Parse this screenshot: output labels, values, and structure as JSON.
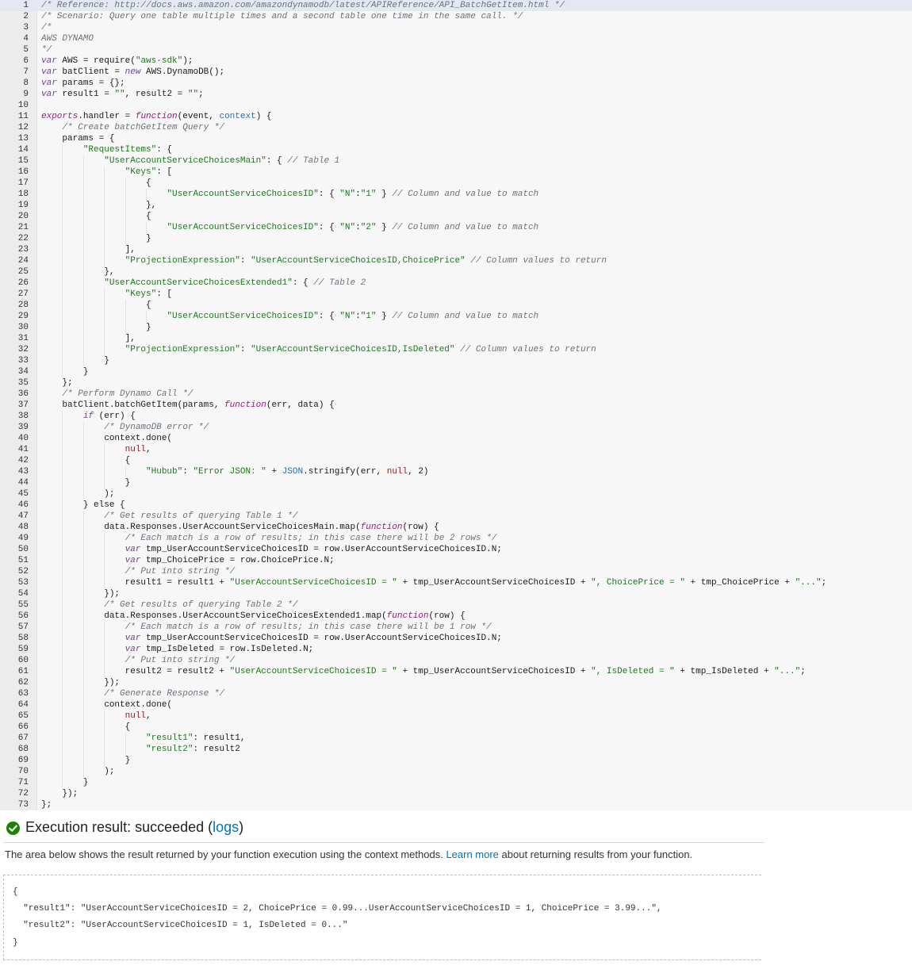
{
  "editor": {
    "active_line": 1,
    "lines": [
      [
        {
          "t": "c",
          "v": "/* Reference: http://docs.aws.amazon.com/amazondynamodb/latest/APIReference/API_BatchGetItem.html */"
        }
      ],
      [
        {
          "t": "c",
          "v": "/* Scenario: Query one table multiple times and a second table one time in the same call. */"
        }
      ],
      [
        {
          "t": "c",
          "v": "/*"
        }
      ],
      [
        {
          "t": "c",
          "v": "AWS DYNAMO"
        }
      ],
      [
        {
          "t": "c",
          "v": "*/"
        }
      ],
      [
        {
          "t": "k",
          "v": "var"
        },
        {
          "t": "n",
          "v": " AWS = require("
        },
        {
          "t": "s",
          "v": "\"aws-sdk\""
        },
        {
          "t": "n",
          "v": ");"
        }
      ],
      [
        {
          "t": "k",
          "v": "var"
        },
        {
          "t": "n",
          "v": " batClient = "
        },
        {
          "t": "k",
          "v": "new"
        },
        {
          "t": "n",
          "v": " AWS.DynamoDB();"
        }
      ],
      [
        {
          "t": "k",
          "v": "var"
        },
        {
          "t": "n",
          "v": " params = {};"
        }
      ],
      [
        {
          "t": "k",
          "v": "var"
        },
        {
          "t": "n",
          "v": " result1 = "
        },
        {
          "t": "s",
          "v": "\"\""
        },
        {
          "t": "n",
          "v": ", result2 = "
        },
        {
          "t": "s",
          "v": "\"\""
        },
        {
          "t": "n",
          "v": ";"
        }
      ],
      [],
      [
        {
          "t": "f",
          "v": "exports"
        },
        {
          "t": "n",
          "v": ".handler = "
        },
        {
          "t": "f",
          "v": "function"
        },
        {
          "t": "n",
          "v": "(event, "
        },
        {
          "t": "v",
          "v": "context"
        },
        {
          "t": "n",
          "v": ") {"
        }
      ],
      [
        {
          "t": "n",
          "v": "    "
        },
        {
          "t": "c",
          "v": "/* Create batchGetItem Query */"
        }
      ],
      [
        {
          "t": "n",
          "v": "    params = {"
        }
      ],
      [
        {
          "t": "n",
          "v": "        "
        },
        {
          "t": "s",
          "v": "\"RequestItems\""
        },
        {
          "t": "n",
          "v": ": {"
        }
      ],
      [
        {
          "t": "n",
          "v": "            "
        },
        {
          "t": "s",
          "v": "\"UserAccountServiceChoicesMain\""
        },
        {
          "t": "n",
          "v": ": { "
        },
        {
          "t": "c",
          "v": "// Table 1"
        }
      ],
      [
        {
          "t": "n",
          "v": "                "
        },
        {
          "t": "s",
          "v": "\"Keys\""
        },
        {
          "t": "n",
          "v": ": ["
        }
      ],
      [
        {
          "t": "n",
          "v": "                    {"
        }
      ],
      [
        {
          "t": "n",
          "v": "                        "
        },
        {
          "t": "s",
          "v": "\"UserAccountServiceChoicesID\""
        },
        {
          "t": "n",
          "v": ": { "
        },
        {
          "t": "s",
          "v": "\"N\""
        },
        {
          "t": "n",
          "v": ":"
        },
        {
          "t": "s",
          "v": "\"1\""
        },
        {
          "t": "n",
          "v": " } "
        },
        {
          "t": "c",
          "v": "// Column and value to match"
        }
      ],
      [
        {
          "t": "n",
          "v": "                    },"
        }
      ],
      [
        {
          "t": "n",
          "v": "                    {"
        }
      ],
      [
        {
          "t": "n",
          "v": "                        "
        },
        {
          "t": "s",
          "v": "\"UserAccountServiceChoicesID\""
        },
        {
          "t": "n",
          "v": ": { "
        },
        {
          "t": "s",
          "v": "\"N\""
        },
        {
          "t": "n",
          "v": ":"
        },
        {
          "t": "s",
          "v": "\"2\""
        },
        {
          "t": "n",
          "v": " } "
        },
        {
          "t": "c",
          "v": "// Column and value to match"
        }
      ],
      [
        {
          "t": "n",
          "v": "                    }"
        }
      ],
      [
        {
          "t": "n",
          "v": "                ],"
        }
      ],
      [
        {
          "t": "n",
          "v": "                "
        },
        {
          "t": "s",
          "v": "\"ProjectionExpression\""
        },
        {
          "t": "n",
          "v": ": "
        },
        {
          "t": "s",
          "v": "\"UserAccountServiceChoicesID,ChoicePrice\""
        },
        {
          "t": "n",
          "v": " "
        },
        {
          "t": "c",
          "v": "// Column values to return"
        }
      ],
      [
        {
          "t": "n",
          "v": "            },"
        }
      ],
      [
        {
          "t": "n",
          "v": "            "
        },
        {
          "t": "s",
          "v": "\"UserAccountServiceChoicesExtended1\""
        },
        {
          "t": "n",
          "v": ": { "
        },
        {
          "t": "c",
          "v": "// Table 2"
        }
      ],
      [
        {
          "t": "n",
          "v": "                "
        },
        {
          "t": "s",
          "v": "\"Keys\""
        },
        {
          "t": "n",
          "v": ": ["
        }
      ],
      [
        {
          "t": "n",
          "v": "                    {"
        }
      ],
      [
        {
          "t": "n",
          "v": "                        "
        },
        {
          "t": "s",
          "v": "\"UserAccountServiceChoicesID\""
        },
        {
          "t": "n",
          "v": ": { "
        },
        {
          "t": "s",
          "v": "\"N\""
        },
        {
          "t": "n",
          "v": ":"
        },
        {
          "t": "s",
          "v": "\"1\""
        },
        {
          "t": "n",
          "v": " } "
        },
        {
          "t": "c",
          "v": "// Column and value to match"
        }
      ],
      [
        {
          "t": "n",
          "v": "                    }"
        }
      ],
      [
        {
          "t": "n",
          "v": "                ],"
        }
      ],
      [
        {
          "t": "n",
          "v": "                "
        },
        {
          "t": "s",
          "v": "\"ProjectionExpression\""
        },
        {
          "t": "n",
          "v": ": "
        },
        {
          "t": "s",
          "v": "\"UserAccountServiceChoicesID,IsDeleted\""
        },
        {
          "t": "n",
          "v": " "
        },
        {
          "t": "c",
          "v": "// Column values to return"
        }
      ],
      [
        {
          "t": "n",
          "v": "            }"
        }
      ],
      [
        {
          "t": "n",
          "v": "        }"
        }
      ],
      [
        {
          "t": "n",
          "v": "    };"
        }
      ],
      [
        {
          "t": "n",
          "v": "    "
        },
        {
          "t": "c",
          "v": "/* Perform Dynamo Call */"
        }
      ],
      [
        {
          "t": "n",
          "v": "    batClient.batchGetItem(params, "
        },
        {
          "t": "f",
          "v": "function"
        },
        {
          "t": "n",
          "v": "(err, data) {"
        }
      ],
      [
        {
          "t": "n",
          "v": "        "
        },
        {
          "t": "k",
          "v": "if"
        },
        {
          "t": "n",
          "v": " (err) {"
        }
      ],
      [
        {
          "t": "n",
          "v": "            "
        },
        {
          "t": "c",
          "v": "/* DynamoDB error */"
        }
      ],
      [
        {
          "t": "n",
          "v": "            context.done("
        }
      ],
      [
        {
          "t": "n",
          "v": "                "
        },
        {
          "t": "b",
          "v": "null"
        },
        {
          "t": "n",
          "v": ","
        }
      ],
      [
        {
          "t": "n",
          "v": "                {"
        }
      ],
      [
        {
          "t": "n",
          "v": "                    "
        },
        {
          "t": "s",
          "v": "\"Hubub\""
        },
        {
          "t": "n",
          "v": ": "
        },
        {
          "t": "s",
          "v": "\"Error JSON: \""
        },
        {
          "t": "n",
          "v": " + "
        },
        {
          "t": "v",
          "v": "JSON"
        },
        {
          "t": "n",
          "v": ".stringify(err, "
        },
        {
          "t": "b",
          "v": "null"
        },
        {
          "t": "n",
          "v": ", 2)"
        }
      ],
      [
        {
          "t": "n",
          "v": "                }"
        }
      ],
      [
        {
          "t": "n",
          "v": "            );"
        }
      ],
      [
        {
          "t": "n",
          "v": "        } else {"
        }
      ],
      [
        {
          "t": "n",
          "v": "            "
        },
        {
          "t": "c",
          "v": "/* Get results of querying Table 1 */"
        }
      ],
      [
        {
          "t": "n",
          "v": "            data.Responses.UserAccountServiceChoicesMain.map("
        },
        {
          "t": "f",
          "v": "function"
        },
        {
          "t": "n",
          "v": "(row) {"
        }
      ],
      [
        {
          "t": "n",
          "v": "                "
        },
        {
          "t": "c",
          "v": "/* Each match is a row of results; in this case there will be 2 rows */"
        }
      ],
      [
        {
          "t": "n",
          "v": "                "
        },
        {
          "t": "k",
          "v": "var"
        },
        {
          "t": "n",
          "v": " tmp_UserAccountServiceChoicesID = row.UserAccountServiceChoicesID.N;"
        }
      ],
      [
        {
          "t": "n",
          "v": "                "
        },
        {
          "t": "k",
          "v": "var"
        },
        {
          "t": "n",
          "v": " tmp_ChoicePrice = row.ChoicePrice.N;"
        }
      ],
      [
        {
          "t": "n",
          "v": "                "
        },
        {
          "t": "c",
          "v": "/* Put into string */"
        }
      ],
      [
        {
          "t": "n",
          "v": "                result1 = result1 + "
        },
        {
          "t": "s",
          "v": "\"UserAccountServiceChoicesID = \""
        },
        {
          "t": "n",
          "v": " + tmp_UserAccountServiceChoicesID + "
        },
        {
          "t": "s",
          "v": "\", ChoicePrice = \""
        },
        {
          "t": "n",
          "v": " + tmp_ChoicePrice + "
        },
        {
          "t": "s",
          "v": "\"...\""
        },
        {
          "t": "n",
          "v": ";"
        }
      ],
      [
        {
          "t": "n",
          "v": "            });"
        }
      ],
      [
        {
          "t": "n",
          "v": "            "
        },
        {
          "t": "c",
          "v": "/* Get results of querying Table 2 */"
        }
      ],
      [
        {
          "t": "n",
          "v": "            data.Responses.UserAccountServiceChoicesExtended1.map("
        },
        {
          "t": "f",
          "v": "function"
        },
        {
          "t": "n",
          "v": "(row) {"
        }
      ],
      [
        {
          "t": "n",
          "v": "                "
        },
        {
          "t": "c",
          "v": "/* Each match is a row of results; in this case there will be 1 row */"
        }
      ],
      [
        {
          "t": "n",
          "v": "                "
        },
        {
          "t": "k",
          "v": "var"
        },
        {
          "t": "n",
          "v": " tmp_UserAccountServiceChoicesID = row.UserAccountServiceChoicesID.N;"
        }
      ],
      [
        {
          "t": "n",
          "v": "                "
        },
        {
          "t": "k",
          "v": "var"
        },
        {
          "t": "n",
          "v": " tmp_IsDeleted = row.IsDeleted.N;"
        }
      ],
      [
        {
          "t": "n",
          "v": "                "
        },
        {
          "t": "c",
          "v": "/* Put into string */"
        }
      ],
      [
        {
          "t": "n",
          "v": "                result2 = result2 + "
        },
        {
          "t": "s",
          "v": "\"UserAccountServiceChoicesID = \""
        },
        {
          "t": "n",
          "v": " + tmp_UserAccountServiceChoicesID + "
        },
        {
          "t": "s",
          "v": "\", IsDeleted = \""
        },
        {
          "t": "n",
          "v": " + tmp_IsDeleted + "
        },
        {
          "t": "s",
          "v": "\"...\""
        },
        {
          "t": "n",
          "v": ";"
        }
      ],
      [
        {
          "t": "n",
          "v": "            });"
        }
      ],
      [
        {
          "t": "n",
          "v": "            "
        },
        {
          "t": "c",
          "v": "/* Generate Response */"
        }
      ],
      [
        {
          "t": "n",
          "v": "            context.done("
        }
      ],
      [
        {
          "t": "n",
          "v": "                "
        },
        {
          "t": "b",
          "v": "null"
        },
        {
          "t": "n",
          "v": ","
        }
      ],
      [
        {
          "t": "n",
          "v": "                {"
        }
      ],
      [
        {
          "t": "n",
          "v": "                    "
        },
        {
          "t": "s",
          "v": "\"result1\""
        },
        {
          "t": "n",
          "v": ": result1,"
        }
      ],
      [
        {
          "t": "n",
          "v": "                    "
        },
        {
          "t": "s",
          "v": "\"result2\""
        },
        {
          "t": "n",
          "v": ": result2"
        }
      ],
      [
        {
          "t": "n",
          "v": "                }"
        }
      ],
      [
        {
          "t": "n",
          "v": "            );"
        }
      ],
      [
        {
          "t": "n",
          "v": "        }"
        }
      ],
      [
        {
          "t": "n",
          "v": "    });"
        }
      ],
      [
        {
          "t": "n",
          "v": "};"
        }
      ]
    ]
  },
  "result": {
    "title_prefix": "Execution result: succeeded (",
    "logs_link": "logs",
    "title_suffix": ")",
    "status_icon": "check-circle-icon",
    "status_color": "#1d8102",
    "description_before": "The area below shows the result returned by your function execution using the context methods. ",
    "learn_more_link": "Learn more",
    "description_after": " about returning results from your function.",
    "output_lines": [
      "{",
      "  \"result1\": \"UserAccountServiceChoicesID = 2, ChoicePrice = 0.99...UserAccountServiceChoicesID = 1, ChoicePrice = 3.99...\",",
      "  \"result2\": \"UserAccountServiceChoicesID = 1, IsDeleted = 0...\"",
      "}"
    ]
  },
  "colors": {
    "comment": "#6a737d",
    "keyword": "#7a3e9d",
    "string": "#1b7a1b",
    "link": "#0073bb",
    "active_line": "#e3e8f3"
  }
}
